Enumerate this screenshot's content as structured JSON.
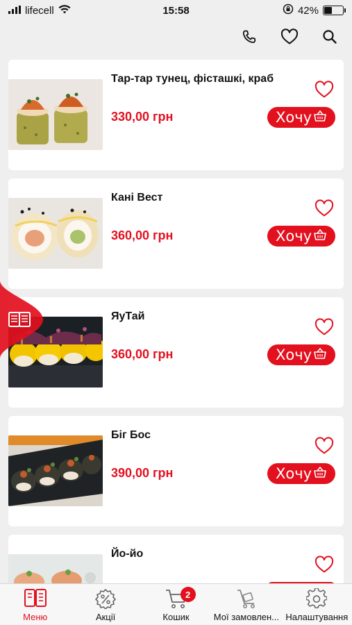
{
  "status_bar": {
    "carrier": "lifecell",
    "time": "15:58",
    "battery": "42%",
    "battery_level": 0.42
  },
  "header": {
    "icons": [
      "phone-icon",
      "heart-icon",
      "search-icon"
    ]
  },
  "products": [
    {
      "name": "Тар-тар тунец, фісташкі, краб",
      "price": "330,00 грн",
      "button": "Хочу"
    },
    {
      "name": "Кані Вест",
      "price": "360,00 грн",
      "button": "Хочу"
    },
    {
      "name": "ЯуТай",
      "price": "360,00 грн",
      "button": "Хочу"
    },
    {
      "name": "Біг Бос",
      "price": "390,00 грн",
      "button": "Хочу"
    },
    {
      "name": "Йо-йо"
    }
  ],
  "tabbar": {
    "items": [
      {
        "label": "Меню",
        "icon": "menu-book-icon",
        "active": true
      },
      {
        "label": "Акції",
        "icon": "discount-icon"
      },
      {
        "label": "Кошик",
        "icon": "cart-icon",
        "badge": "2"
      },
      {
        "label": "Мої замовлен...",
        "icon": "orders-trolley-icon"
      },
      {
        "label": "Налаштування",
        "icon": "gear-icon"
      }
    ]
  },
  "colors": {
    "accent": "#e3101e",
    "background": "#efefef",
    "card": "#ffffff"
  }
}
